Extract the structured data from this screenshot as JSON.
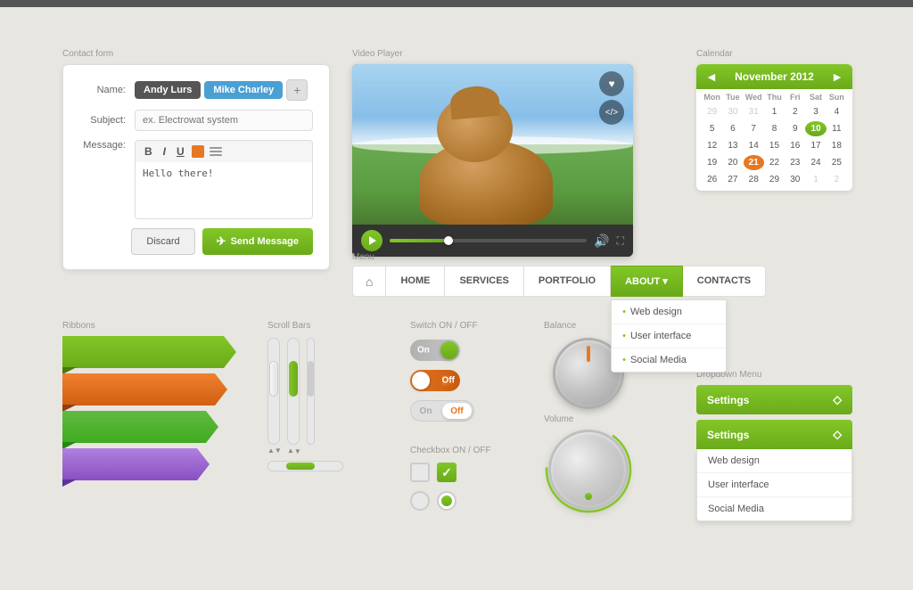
{
  "app": {
    "top_bar_color": "#555555",
    "bg_color": "#e8e6e0"
  },
  "contact_form": {
    "section_label": "Contact form",
    "name_label": "Name:",
    "tag1": "Andy Lurs",
    "tag2": "Mike Charley",
    "add_btn": "+",
    "subject_label": "Subject:",
    "subject_placeholder": "ex. Electrowat system",
    "message_label": "Message:",
    "toolbar_bold": "B",
    "toolbar_italic": "I",
    "toolbar_underline": "U",
    "message_text": "Hello there!",
    "discard_btn": "Discard",
    "send_btn": "Send Message",
    "send_icon": "✈"
  },
  "video_player": {
    "section_label": "Video Player",
    "heart_icon": "♥",
    "code_icon": "</>",
    "fullscreen_chars": "⛶"
  },
  "calendar": {
    "section_label": "Calendar",
    "month": "November 2012",
    "prev": "◄",
    "next": "►",
    "day_headers": [
      "Mon",
      "Tue",
      "Wed",
      "Thu",
      "Fri",
      "Sat",
      "Sun"
    ],
    "weeks": [
      [
        "29",
        "30",
        "31",
        "1",
        "2",
        "3",
        "4"
      ],
      [
        "5",
        "6",
        "7",
        "8",
        "9",
        "10",
        "11"
      ],
      [
        "12",
        "13",
        "14",
        "15",
        "16",
        "17",
        "18"
      ],
      [
        "19",
        "20",
        "21",
        "22",
        "23",
        "24",
        "25"
      ],
      [
        "26",
        "27",
        "28",
        "29",
        "30",
        "1",
        "2"
      ]
    ],
    "today": "21",
    "selected": "10",
    "other_month_start": [
      "29",
      "30",
      "31"
    ],
    "other_month_end": [
      "1",
      "2"
    ]
  },
  "menu": {
    "section_label": "Menu",
    "home_icon": "⌂",
    "items": [
      "HOME",
      "SERVICES",
      "PORTFOLIO",
      "ABOUT▾",
      "CONTACTS"
    ],
    "active": "ABOUT▾",
    "about_dropdown": [
      "• Web design",
      "• User interface",
      "• Social Media"
    ]
  },
  "dropdown_menu": {
    "section_label": "Dropdown Menu",
    "closed_label": "Settings",
    "open_label": "Settings",
    "arrow": "⬦",
    "items": [
      "Web design",
      "User interface",
      "Social Media"
    ]
  },
  "ribbons": {
    "section_label": "Ribbons",
    "colors": [
      "#82c727",
      "#f08030",
      "#60bb40",
      "#b080e0"
    ]
  },
  "scrollbars": {
    "section_label": "Scroll Bars"
  },
  "switches": {
    "section_label": "Switch ON / OFF",
    "on_label": "On",
    "off_label": "Off"
  },
  "checkboxes": {
    "section_label": "Checkbox ON / OFF",
    "check_mark": "✓"
  },
  "balance": {
    "section_label": "Balance"
  },
  "volume": {
    "section_label": "Volume"
  }
}
